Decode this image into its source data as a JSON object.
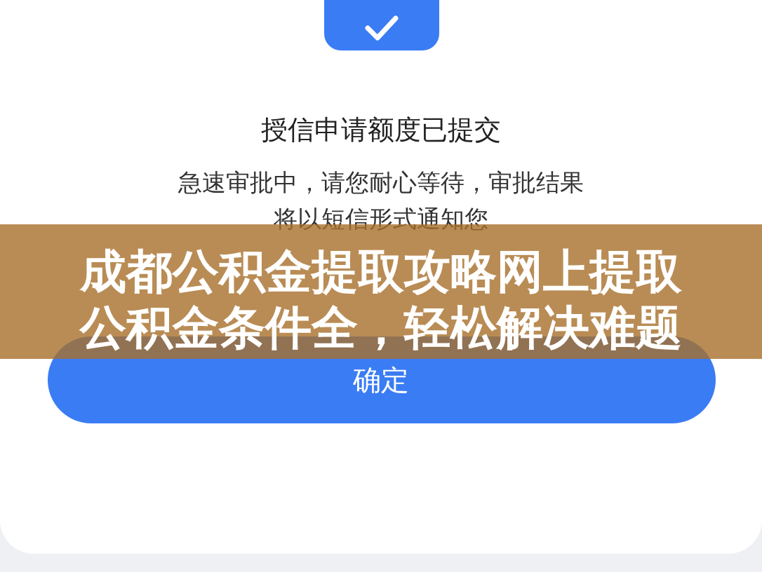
{
  "dialog": {
    "title": "授信申请额度已提交",
    "message_lines": [
      "急速审批中，请您耐心等待，审批结果",
      "将以短信形式通知您"
    ],
    "confirm_button": "确定"
  },
  "banner": {
    "lines": [
      "成都公积金提取攻略网上提取",
      "公积金条件全，轻松解决难题"
    ]
  }
}
